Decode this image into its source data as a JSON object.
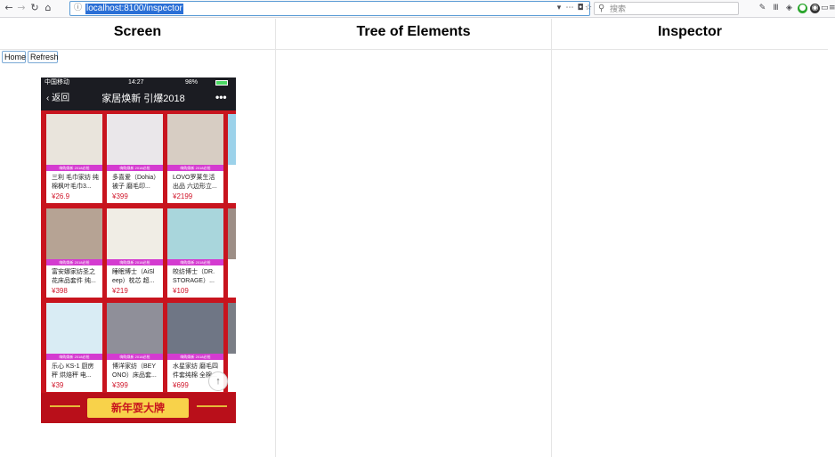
{
  "browser": {
    "url": "localhost:8100/inspector",
    "search_placeholder": "搜索",
    "icons": [
      "back-icon",
      "forward-icon",
      "reload-icon",
      "home-icon",
      "info-icon",
      "dropdown-icon",
      "more-icon",
      "pocket-icon",
      "bookmark-star-icon",
      "search-icon",
      "tools-icon",
      "library-icon",
      "sync-icon",
      "green-extension-icon",
      "dark-extension-icon",
      "sidebar-icon",
      "menu-icon"
    ]
  },
  "columns": {
    "screen": "Screen",
    "tree": "Tree of Elements",
    "inspector": "Inspector"
  },
  "controls": {
    "home": "Home",
    "refresh": "Refresh"
  },
  "phone": {
    "carrier": "中国移动",
    "time": "14:27",
    "battery": "98%",
    "battery_level": 0.98,
    "back_label": "返回",
    "title": "家居焕新 引爆2018",
    "more_label": "•••",
    "banner": "新年耍大牌",
    "scroll_top_label": "↑",
    "strip_label": "嗨购焕新 2018必抢"
  },
  "products": [
    {
      "name": "三利 毛巾家纺 纯棉枫叶毛巾3...",
      "price": "¥26.9",
      "img_color": "#e9e4dc"
    },
    {
      "name": "多喜爱（Dohia）被子 磨毛印...",
      "price": "¥399",
      "img_color": "#eae7ea"
    },
    {
      "name": "LOVO罗莱生活 出品 六边形立...",
      "price": "¥2199",
      "img_color": "#d7cdc3"
    },
    {
      "name": "富安娜家纺圣之 花床品套件 纯...",
      "price": "¥398",
      "img_color": "#b6a394"
    },
    {
      "name": "睡眠博士（AiSl eep）枕芯 超...",
      "price": "¥219",
      "img_color": "#f0ede5"
    },
    {
      "name": "皎纺博士（DR. STORAGE）...",
      "price": "¥109",
      "img_color": "#a9d6dc"
    },
    {
      "name": "乐心 KS-1 厨房 秤 烘焙秤 电...",
      "price": "¥39",
      "img_color": "#d9ecf4"
    },
    {
      "name": "博洋家纺（BEY ONO）床品套...",
      "price": "¥399",
      "img_color": "#8f8f99"
    },
    {
      "name": "水星家纺 磨毛四 件套纯棉 全棉...",
      "price": "¥699",
      "img_color": "#6f7685"
    }
  ],
  "colors": {
    "phone_bg": "#c8141e",
    "nav_bg": "#1b1c22",
    "price": "#d0162a",
    "strip": "#d43bd0",
    "banner_pill": "#f8d24a",
    "url_highlight": "#2a6fd6"
  }
}
